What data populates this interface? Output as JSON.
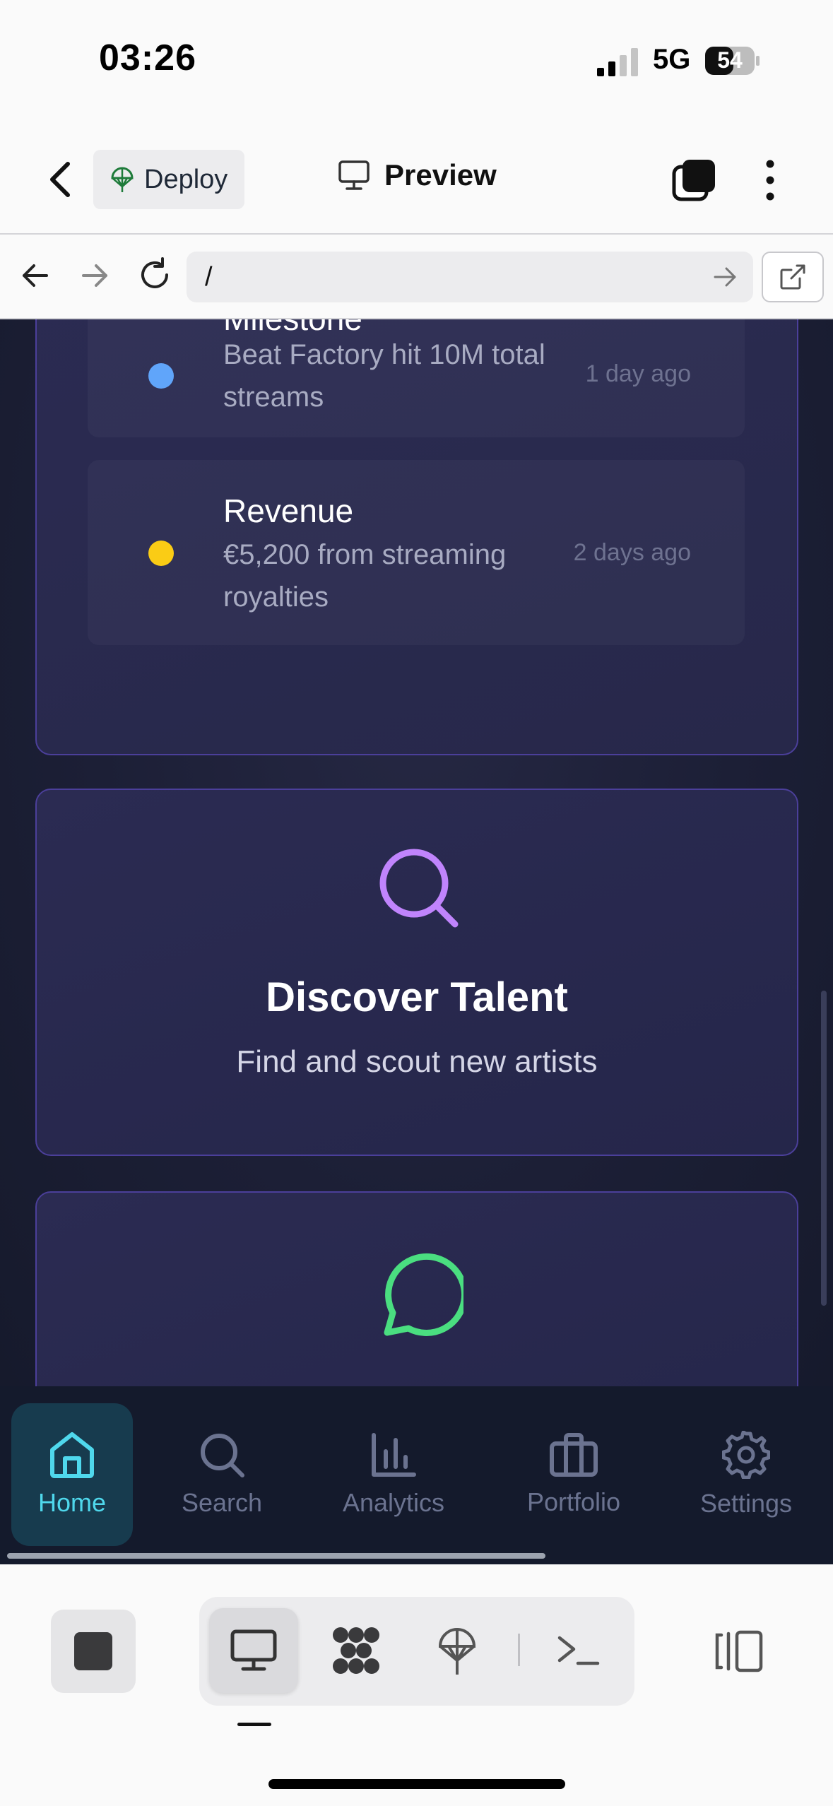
{
  "status_bar": {
    "time": "03:26",
    "network": "5G",
    "battery": "54"
  },
  "toolbar": {
    "deploy_label": "Deploy",
    "preview_label": "Preview"
  },
  "url_bar": {
    "url": "/"
  },
  "activity": {
    "items": [
      {
        "title": "Milestone",
        "description": "Beat Factory hit 10M total streams",
        "time": "1 day ago",
        "dot_color": "#60a5fa"
      },
      {
        "title": "Revenue",
        "description": "€5,200 from streaming royalties",
        "time": "2 days ago",
        "dot_color": "#facc15"
      }
    ]
  },
  "cards": [
    {
      "title": "Discover Talent",
      "subtitle": "Find and scout new artists",
      "icon": "search-icon",
      "icon_color": "#c084fc"
    },
    {
      "title": "",
      "subtitle": "",
      "icon": "message-circle-icon",
      "icon_color": "#4ade80"
    }
  ],
  "bottom_nav": {
    "items": [
      {
        "label": "Home",
        "icon": "home-icon",
        "active": true
      },
      {
        "label": "Search",
        "icon": "search-icon",
        "active": false
      },
      {
        "label": "Analytics",
        "icon": "bar-chart-icon",
        "active": false
      },
      {
        "label": "Portfolio",
        "icon": "briefcase-icon",
        "active": false
      },
      {
        "label": "Settings",
        "icon": "gear-icon",
        "active": false
      }
    ]
  },
  "colors": {
    "accent": "#4fd8ec",
    "card_border": "#4b3f9a",
    "background": "#1c1f36"
  }
}
